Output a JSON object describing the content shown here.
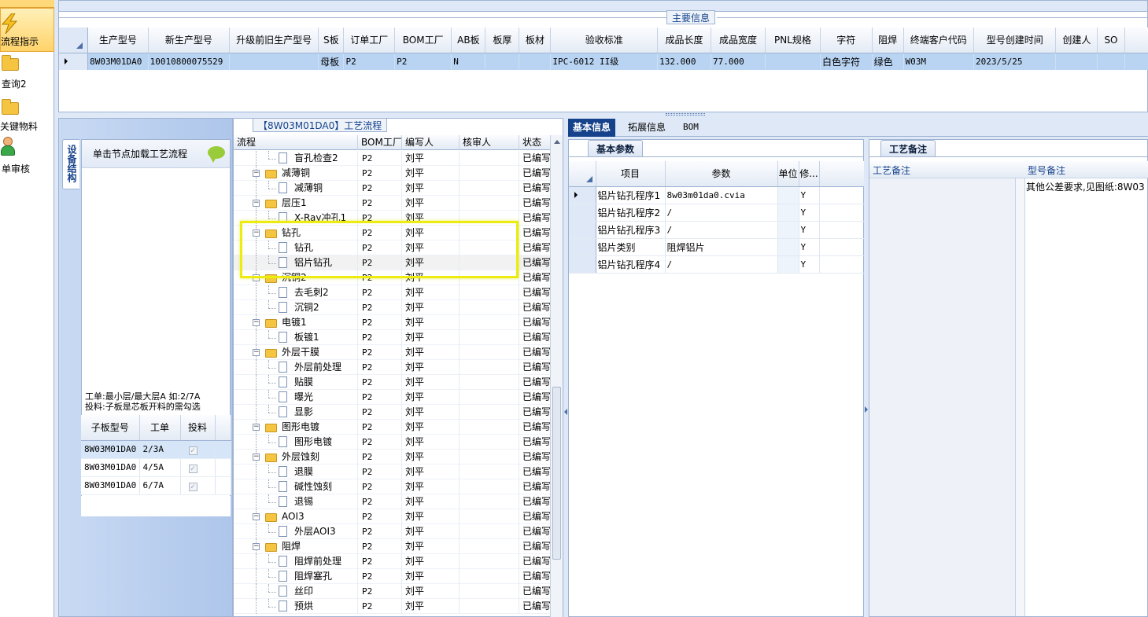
{
  "nav": {
    "items": [
      {
        "label": "流程指示",
        "icon": "lightning-icon",
        "selected": true
      },
      {
        "label": "查询2",
        "icon": "folder-icon"
      },
      {
        "label": "关键物料",
        "icon": "folder-icon"
      },
      {
        "label": "单审核",
        "icon": "user-icon"
      }
    ]
  },
  "main_info": {
    "title": "主要信息",
    "columns": [
      "生产型号",
      "新生产型号",
      "升级前旧生产型号",
      "S板",
      "订单工厂",
      "BOM工厂",
      "AB板",
      "板厚",
      "板材",
      "验收标准",
      "成品长度",
      "成品宽度",
      "PNL规格",
      "字符",
      "阻焊",
      "终端客户代码",
      "型号创建时间",
      "创建人",
      "SO"
    ],
    "row": [
      "8W03M01DA0",
      "10010800075529",
      "",
      "母板",
      "P2",
      "P2",
      "N",
      "",
      "",
      "IPC-6012 II级",
      "132.000",
      "77.000",
      "",
      "白色字符",
      "绿色",
      "W03M",
      "2023/5/25",
      "",
      ""
    ]
  },
  "sidebar": {
    "tab_label": "设备结构",
    "header": "单击节点加载工艺流程",
    "note_line1": "工单:最小层/最大层A 如:2/7A",
    "note_line2": "投料:子板是芯板开料的需勾选",
    "sub_columns": [
      "子板型号",
      "工单",
      "投料"
    ],
    "sub_rows": [
      {
        "model": "8W03M01DA0",
        "order": "2/3A",
        "feed": true
      },
      {
        "model": "8W03M01DA0",
        "order": "4/5A",
        "feed": true
      },
      {
        "model": "8W03M01DA0",
        "order": "6/7A",
        "feed": true
      }
    ]
  },
  "process": {
    "title": "【8W03M01DA0】工艺流程",
    "columns": [
      "流程",
      "BOM工厂",
      "编写人",
      "核审人",
      "状态"
    ],
    "rows": [
      {
        "name": "盲孔检查2",
        "type": "doc",
        "bom": "P2",
        "author": "刘平",
        "reviewer": "",
        "status": "已编写"
      },
      {
        "name": "减薄铜",
        "type": "folder",
        "bom": "P2",
        "author": "刘平",
        "reviewer": "",
        "status": "已编写"
      },
      {
        "name": "减薄铜",
        "type": "doc",
        "bom": "P2",
        "author": "刘平",
        "reviewer": "",
        "status": "已编写"
      },
      {
        "name": "层压1",
        "type": "folder",
        "bom": "P2",
        "author": "刘平",
        "reviewer": "",
        "status": "已编写"
      },
      {
        "name": "X-Ray冲孔1",
        "type": "doc",
        "bom": "P2",
        "author": "刘平",
        "reviewer": "",
        "status": "已编写"
      },
      {
        "name": "钻孔",
        "type": "folder",
        "bom": "P2",
        "author": "刘平",
        "reviewer": "",
        "status": "已编写"
      },
      {
        "name": "钻孔",
        "type": "doc",
        "bom": "P2",
        "author": "刘平",
        "reviewer": "",
        "status": "已编写"
      },
      {
        "name": "铝片钻孔",
        "type": "doc",
        "bom": "P2",
        "author": "刘平",
        "reviewer": "",
        "status": "已编写",
        "highlight": true
      },
      {
        "name": "沉铜2",
        "type": "folder",
        "bom": "P2",
        "author": "刘平",
        "reviewer": "",
        "status": "已编写"
      },
      {
        "name": "去毛刺2",
        "type": "doc",
        "bom": "P2",
        "author": "刘平",
        "reviewer": "",
        "status": "已编写"
      },
      {
        "name": "沉铜2",
        "type": "doc",
        "bom": "P2",
        "author": "刘平",
        "reviewer": "",
        "status": "已编写"
      },
      {
        "name": "电镀1",
        "type": "folder",
        "bom": "P2",
        "author": "刘平",
        "reviewer": "",
        "status": "已编写"
      },
      {
        "name": "板镀1",
        "type": "doc",
        "bom": "P2",
        "author": "刘平",
        "reviewer": "",
        "status": "已编写"
      },
      {
        "name": "外层干膜",
        "type": "folder",
        "bom": "P2",
        "author": "刘平",
        "reviewer": "",
        "status": "已编写"
      },
      {
        "name": "外层前处理",
        "type": "doc",
        "bom": "P2",
        "author": "刘平",
        "reviewer": "",
        "status": "已编写"
      },
      {
        "name": "贴膜",
        "type": "doc",
        "bom": "P2",
        "author": "刘平",
        "reviewer": "",
        "status": "已编写"
      },
      {
        "name": "曝光",
        "type": "doc",
        "bom": "P2",
        "author": "刘平",
        "reviewer": "",
        "status": "已编写"
      },
      {
        "name": "显影",
        "type": "doc",
        "bom": "P2",
        "author": "刘平",
        "reviewer": "",
        "status": "已编写"
      },
      {
        "name": "图形电镀",
        "type": "folder",
        "bom": "P2",
        "author": "刘平",
        "reviewer": "",
        "status": "已编写"
      },
      {
        "name": "图形电镀",
        "type": "doc",
        "bom": "P2",
        "author": "刘平",
        "reviewer": "",
        "status": "已编写"
      },
      {
        "name": "外层蚀刻",
        "type": "folder",
        "bom": "P2",
        "author": "刘平",
        "reviewer": "",
        "status": "已编写"
      },
      {
        "name": "退膜",
        "type": "doc",
        "bom": "P2",
        "author": "刘平",
        "reviewer": "",
        "status": "已编写"
      },
      {
        "name": "碱性蚀刻",
        "type": "doc",
        "bom": "P2",
        "author": "刘平",
        "reviewer": "",
        "status": "已编写"
      },
      {
        "name": "退锡",
        "type": "doc",
        "bom": "P2",
        "author": "刘平",
        "reviewer": "",
        "status": "已编写"
      },
      {
        "name": "AOI3",
        "type": "folder",
        "bom": "P2",
        "author": "刘平",
        "reviewer": "",
        "status": "已编写"
      },
      {
        "name": "外层AOI3",
        "type": "doc",
        "bom": "P2",
        "author": "刘平",
        "reviewer": "",
        "status": "已编写"
      },
      {
        "name": "阻焊",
        "type": "folder",
        "bom": "P2",
        "author": "刘平",
        "reviewer": "",
        "status": "已编写"
      },
      {
        "name": "阻焊前处理",
        "type": "doc",
        "bom": "P2",
        "author": "刘平",
        "reviewer": "",
        "status": "已编写"
      },
      {
        "name": "阻焊塞孔",
        "type": "doc",
        "bom": "P2",
        "author": "刘平",
        "reviewer": "",
        "status": "已编写"
      },
      {
        "name": "丝印",
        "type": "doc",
        "bom": "P2",
        "author": "刘平",
        "reviewer": "",
        "status": "已编写"
      },
      {
        "name": "预烘",
        "type": "doc",
        "bom": "P2",
        "author": "刘平",
        "reviewer": "",
        "status": "已编写"
      }
    ]
  },
  "detail_tabs": [
    "基本信息",
    "拓展信息",
    "BOM"
  ],
  "params": {
    "title": "基本参数",
    "columns": [
      "项目",
      "参数",
      "单位",
      "修..."
    ],
    "rows": [
      {
        "item": "铝片钻孔程序1",
        "value": "8w03m01da0.cvia",
        "unit": "",
        "mod": "Y"
      },
      {
        "item": "铝片钻孔程序2",
        "value": "/",
        "unit": "",
        "mod": "Y"
      },
      {
        "item": "铝片钻孔程序3",
        "value": "/",
        "unit": "",
        "mod": "Y"
      },
      {
        "item": "铝片类别",
        "value": "阻焊铝片",
        "unit": "",
        "mod": "Y"
      },
      {
        "item": "铝片钻孔程序4",
        "value": "/",
        "unit": "",
        "mod": "Y"
      }
    ]
  },
  "notes": {
    "title": "工艺备注",
    "col_process": "工艺备注",
    "col_model": "型号备注",
    "model_note": "其他公差要求,见图纸:8W03"
  },
  "colors": {
    "accent": "#15428b",
    "selection": "#b9d4f2",
    "highlight_box": "#ecec10"
  }
}
